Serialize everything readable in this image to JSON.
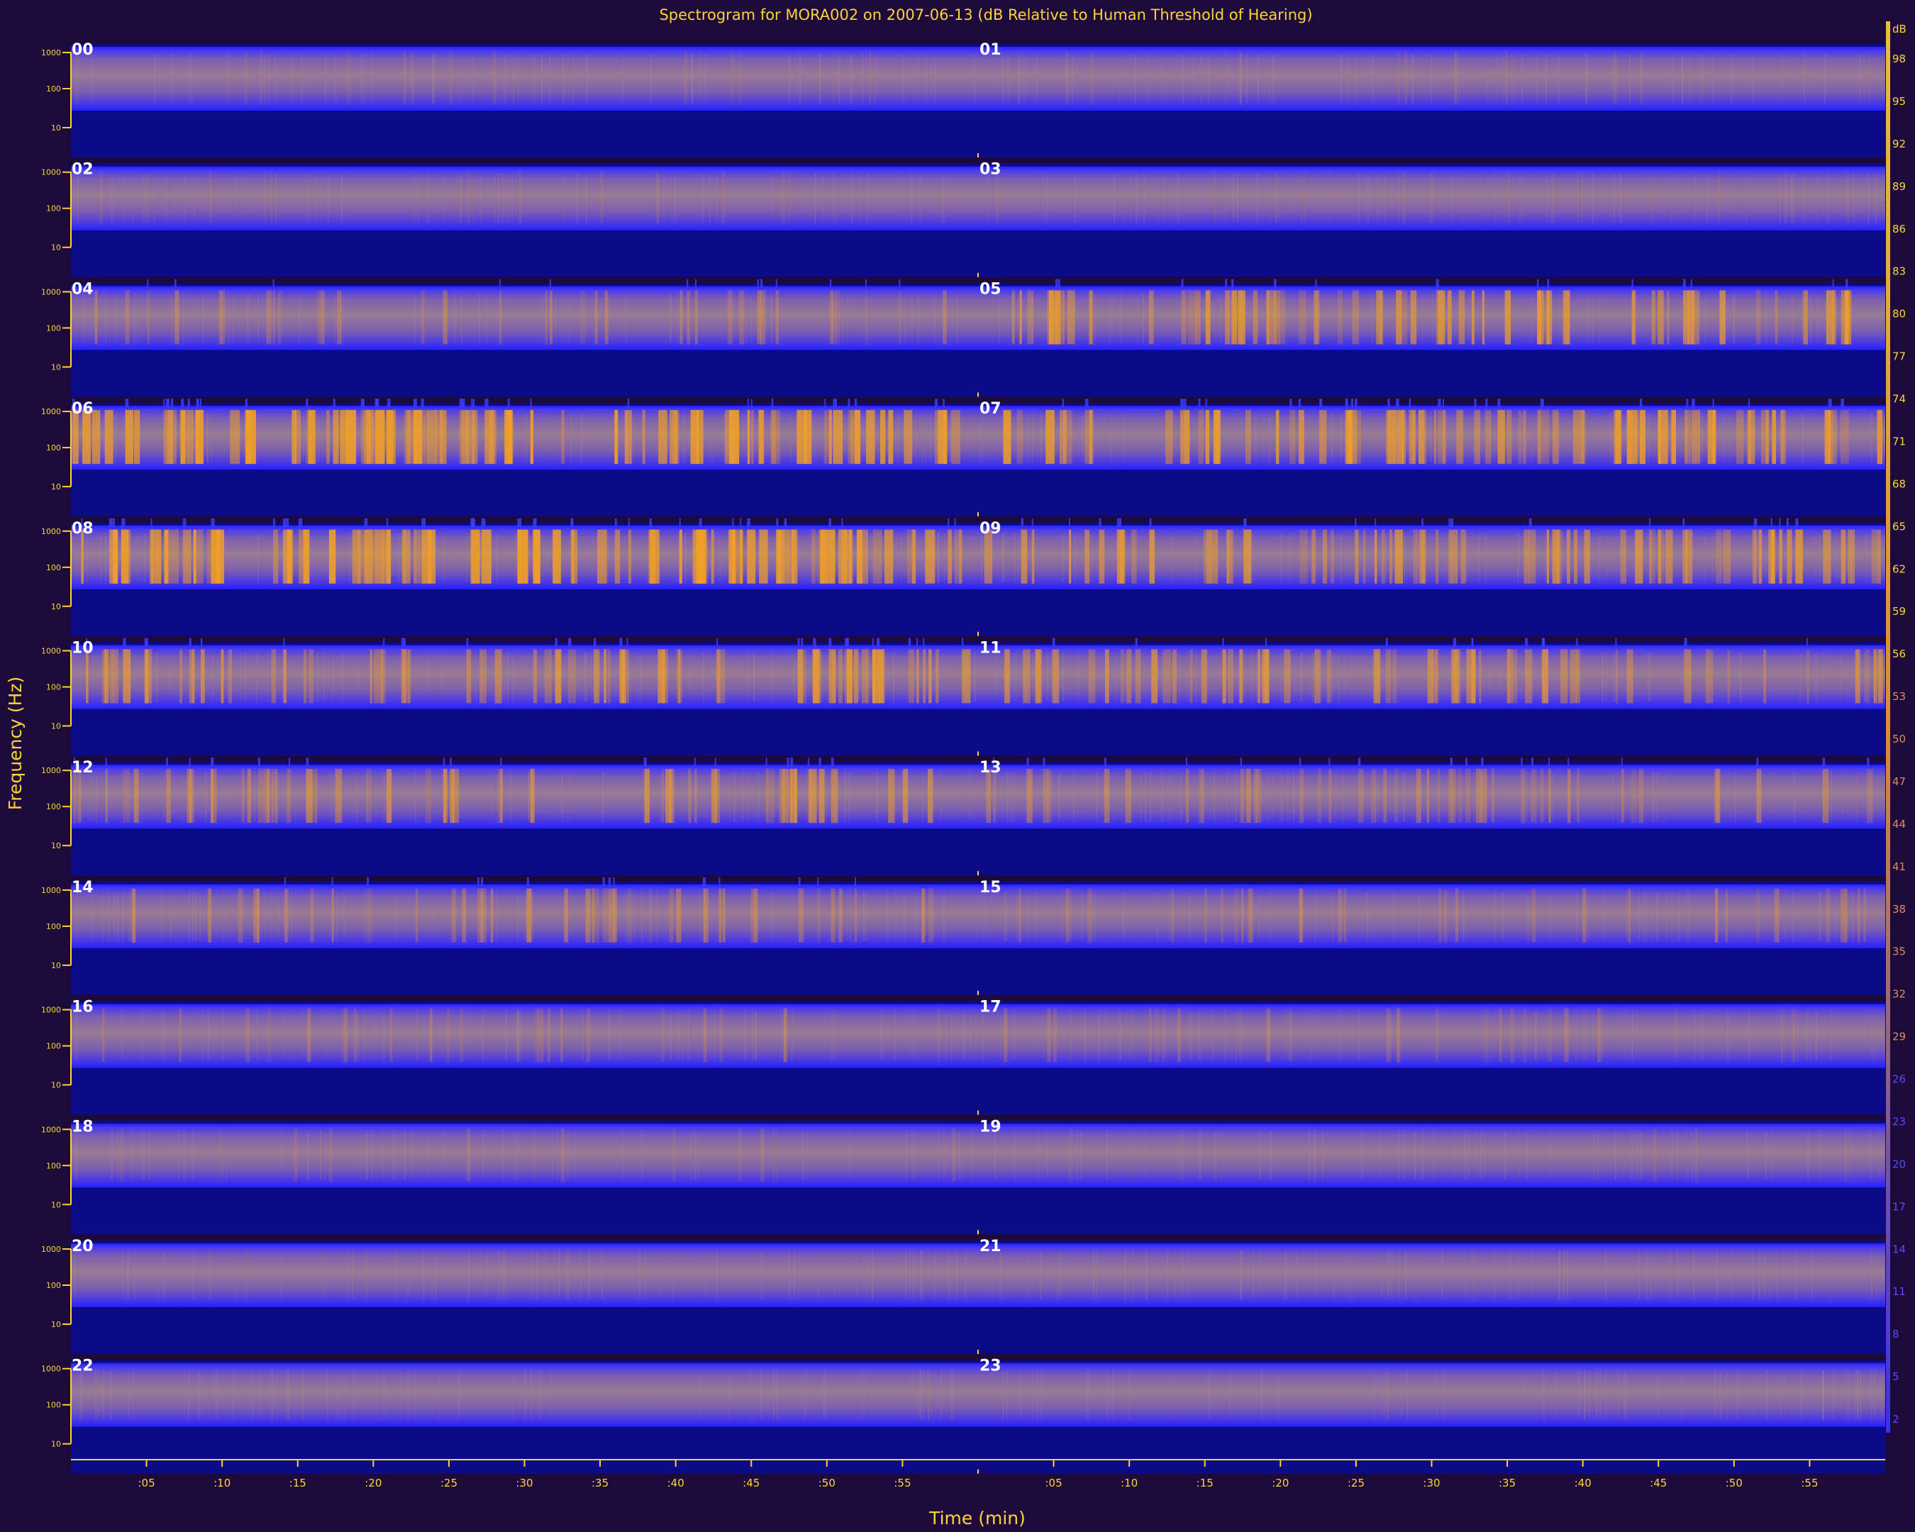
{
  "chart_data": {
    "type": "heatmap",
    "title": "Spectrogram for MORA002 on 2007-06-13 (dB Relative to Human Threshold of Hearing)",
    "xlabel": "Time (min)",
    "ylabel": "Frequency (Hz)",
    "x_tick_labels": [
      ":05",
      ":10",
      ":15",
      ":20",
      ":25",
      ":30",
      ":35",
      ":40",
      ":45",
      ":50",
      ":55"
    ],
    "x_range_min": [
      0,
      60
    ],
    "panel_hours": [
      "00",
      "01",
      "02",
      "03",
      "04",
      "05",
      "06",
      "07",
      "08",
      "09",
      "10",
      "11",
      "12",
      "13",
      "14",
      "15",
      "16",
      "17",
      "18",
      "19",
      "20",
      "21",
      "22",
      "23"
    ],
    "freq_tick_labels": [
      "1000",
      "100",
      "10"
    ],
    "colorbar_unit": "dB",
    "colorbar_labels": [
      "98",
      "95",
      "92",
      "89",
      "86",
      "83",
      "80",
      "77",
      "74",
      "71",
      "68",
      "65",
      "62",
      "59",
      "56",
      "53",
      "50",
      "47",
      "44",
      "41",
      "38",
      "35",
      "32",
      "29",
      "26",
      "23",
      "20",
      "17",
      "14",
      "11",
      "8",
      "5",
      "2"
    ],
    "colorbar_range_db": [
      0,
      100
    ],
    "hourly_activity": [
      0.12,
      0.12,
      0.1,
      0.1,
      0.32,
      0.62,
      0.82,
      0.72,
      0.82,
      0.62,
      0.62,
      0.55,
      0.52,
      0.4,
      0.38,
      0.28,
      0.22,
      0.22,
      0.14,
      0.1,
      0.05,
      0.05,
      0.05,
      0.05
    ],
    "colors": {
      "background": "#1c0b3a",
      "panel": "#0c0a86",
      "band_edge": "#2626ff",
      "band_mid": "#8a6a9c",
      "loud": "#f2a024",
      "axis": "#ffd23a"
    }
  }
}
